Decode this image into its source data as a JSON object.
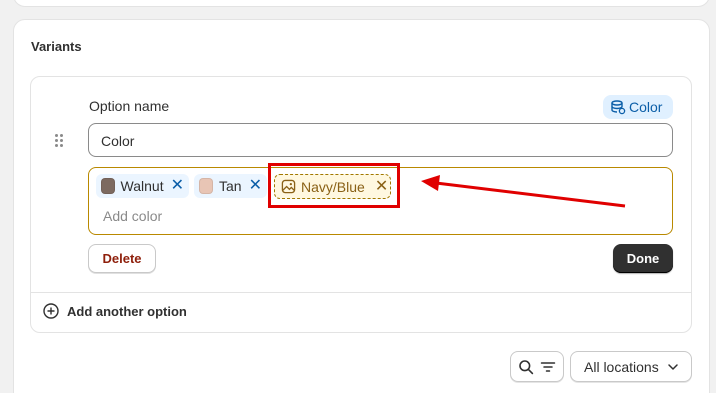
{
  "section": {
    "title": "Variants"
  },
  "option": {
    "name_label": "Option name",
    "metafield_badge": "Color",
    "name_value": "Color",
    "values": [
      {
        "label": "Walnut",
        "swatch_color": "#7d6a60"
      },
      {
        "label": "Tan",
        "swatch_color": "#e8c5b5"
      }
    ],
    "new_value": {
      "label": "Navy/Blue",
      "icon": "image-icon"
    },
    "add_placeholder": "Add color",
    "delete_label": "Delete",
    "done_label": "Done"
  },
  "add_another_label": "Add another option",
  "toolbar": {
    "search_icon": "search-icon",
    "filter_icon": "filter-icon",
    "locations_label": "All locations"
  },
  "annotation": {
    "color": "#e00000"
  },
  "colors": {
    "accent_tag": "#ebf5ff",
    "remove_x": "#0b5ea8",
    "new_tag_border": "#a07800",
    "values_border": "#b98900",
    "done_bg": "#303030",
    "delete_text": "#8e1f0b"
  }
}
